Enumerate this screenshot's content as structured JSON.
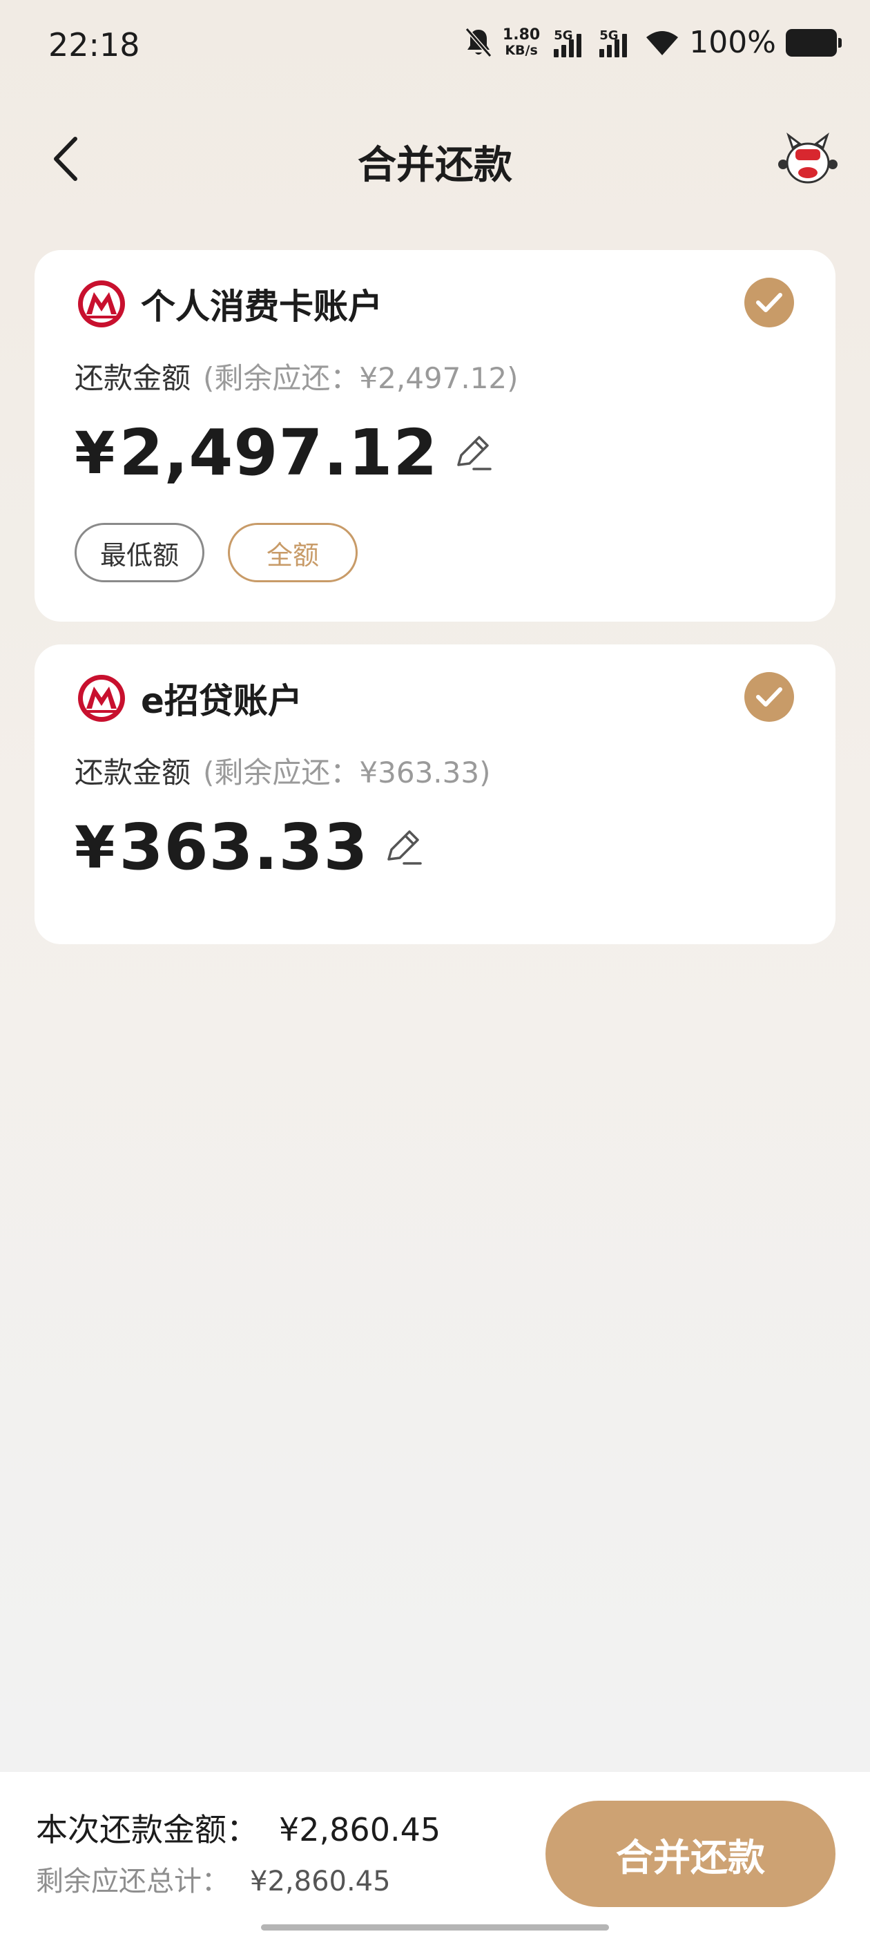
{
  "status_bar": {
    "time": "22:18",
    "net_speed_value": "1.80",
    "net_speed_unit": "KB/s",
    "sim1_label": "5G",
    "sim2_label": "5G",
    "battery_percent": "100%",
    "icons": [
      "bell-muted-icon",
      "signal-icon",
      "wifi-icon",
      "battery-icon"
    ]
  },
  "header": {
    "title": "合并还款",
    "back_icon": "chevron-left-icon",
    "mascot_icon": "mascot-icon"
  },
  "accounts": [
    {
      "name": "个人消费卡账户",
      "label": "还款金额",
      "remaining_text": "(剩余应还：¥2,497.12)",
      "currency": "¥",
      "amount": "2,497.12",
      "checked": true,
      "chips": [
        "最低额",
        "全额"
      ]
    },
    {
      "name": "e招贷账户",
      "label": "还款金额",
      "remaining_text": "(剩余应还：¥363.33)",
      "currency": "¥",
      "amount": "363.33",
      "checked": true
    }
  ],
  "footer": {
    "total_label": "本次还款金额：",
    "total_value": "¥2,860.45",
    "remain_label": "剩余应还总计：",
    "remain_value": "¥2,860.45",
    "button_label": "合并还款"
  },
  "colors": {
    "accent": "#c89b68",
    "button": "#cda273",
    "bank_red": "#c8102e"
  }
}
